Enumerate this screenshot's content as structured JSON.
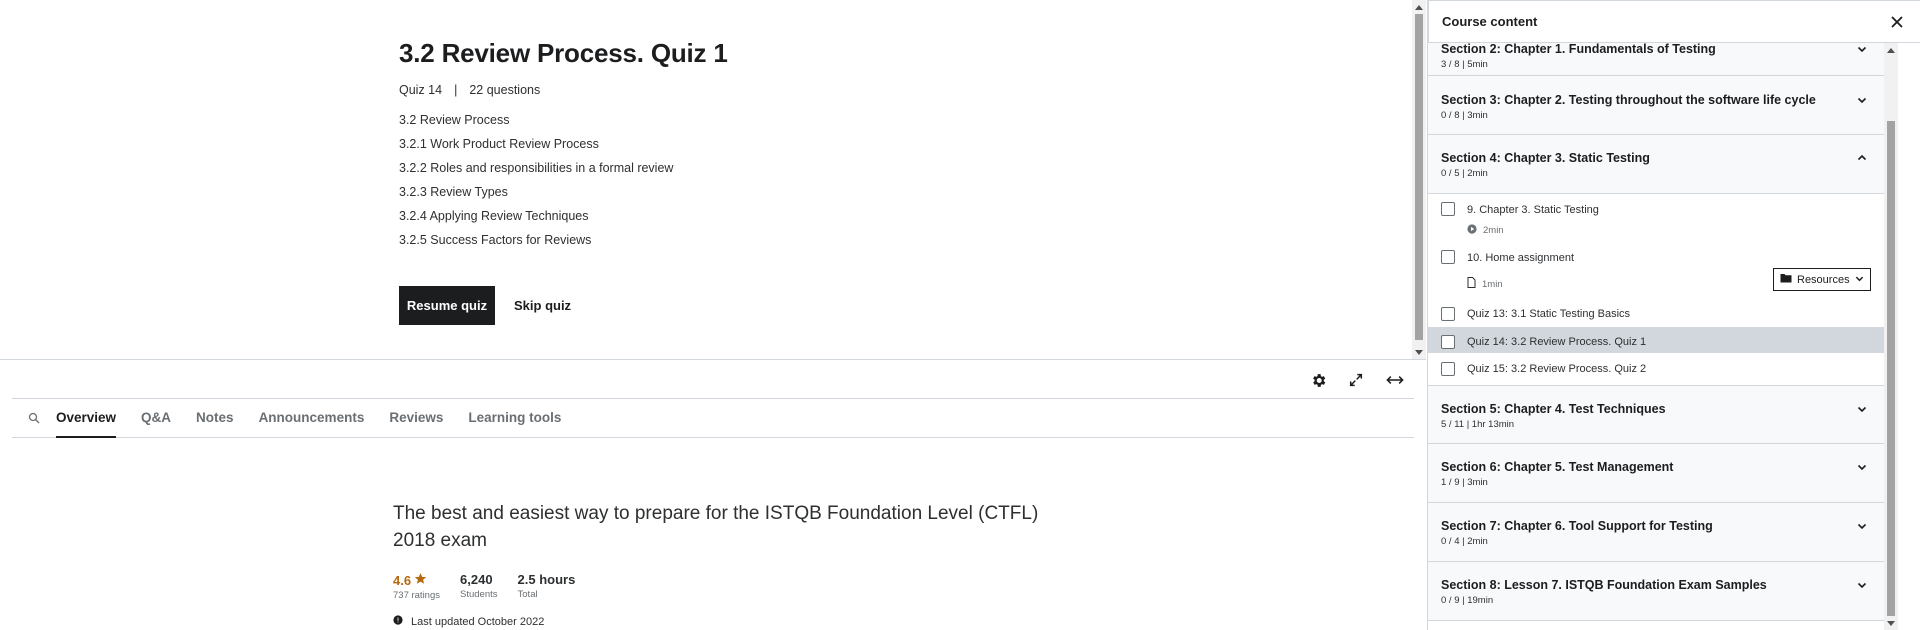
{
  "quiz": {
    "title": "3.2 Review Process. Quiz 1",
    "number": "Quiz 14",
    "separator": "|",
    "question_count": "22 questions",
    "topics": [
      "3.2 Review Process",
      "3.2.1 Work Product Review Process",
      "3.2.2 Roles and responsibilities in a formal review",
      "3.2.3 Review Types",
      "3.2.4 Applying Review Techniques",
      "3.2.5 Success Factors for Reviews"
    ],
    "resume_label": "Resume quiz",
    "skip_label": "Skip quiz"
  },
  "controls": {
    "settings_icon": "gear-icon",
    "fullscreen_icon": "expand-icon",
    "expand_width_icon": "horizontal-arrows-icon"
  },
  "tabs": [
    "Overview",
    "Q&A",
    "Notes",
    "Announcements",
    "Reviews",
    "Learning tools"
  ],
  "active_tab": "Overview",
  "overview": {
    "headline": "The best and easiest way to prepare for the ISTQB Foundation Level (CTFL) 2018 exam",
    "rating": "4.6",
    "ratings_count": "737 ratings",
    "students": "6,240",
    "students_label": "Students",
    "hours": "2.5 hours",
    "hours_label": "Total",
    "last_updated": "Last updated October 2022"
  },
  "sidebar": {
    "title": "Course content",
    "sections": [
      {
        "title": "Section 2: Chapter 1. Fundamentals of Testing",
        "meta": "3 / 8 | 5min",
        "expanded": false
      },
      {
        "title": "Section 3: Chapter 2. Testing throughout the software life cycle",
        "meta": "0 / 8 | 3min",
        "expanded": false
      },
      {
        "title": "Section 4: Chapter 3. Static Testing",
        "meta": "0 / 5 | 2min",
        "expanded": true
      },
      {
        "title": "Section 5: Chapter 4. Test Techniques",
        "meta": "5 / 11 | 1hr 13min",
        "expanded": false
      },
      {
        "title": "Section 6: Chapter 5. Test Management",
        "meta": "1 / 9 | 3min",
        "expanded": false
      },
      {
        "title": "Section 7: Chapter 6. Tool Support for Testing",
        "meta": "0 / 4 | 2min",
        "expanded": false
      },
      {
        "title": "Section 8: Lesson 7. ISTQB Foundation Exam Samples",
        "meta": "0 / 9 | 19min",
        "expanded": false
      }
    ],
    "items": [
      {
        "title": "9. Chapter 3. Static Testing",
        "meta": "2min",
        "icon": "play-circle-icon"
      },
      {
        "title": "10. Home assignment",
        "meta": "1min",
        "icon": "file-icon",
        "resources_label": "Resources"
      },
      {
        "title": "Quiz 13: 3.1 Static Testing Basics"
      },
      {
        "title": "Quiz 14: 3.2 Review Process. Quiz 1",
        "current": true
      },
      {
        "title": "Quiz 15: 3.2 Review Process. Quiz 2"
      }
    ]
  }
}
